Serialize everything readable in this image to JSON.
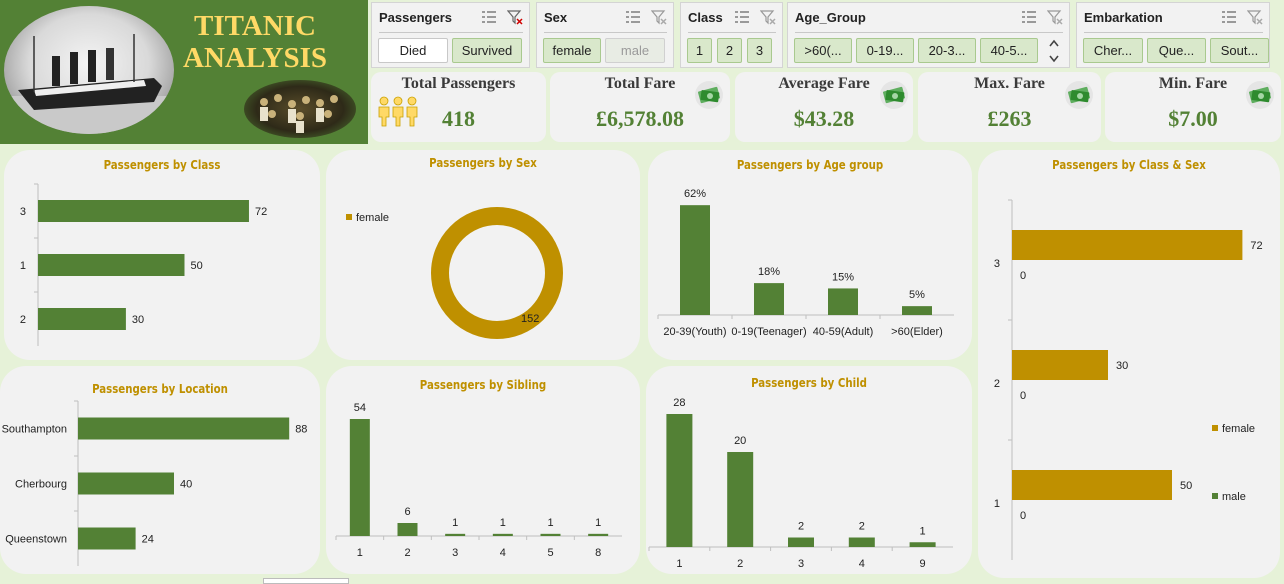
{
  "header": {
    "title_line1": "TITANIC",
    "title_line2": "ANALYSIS"
  },
  "slicers": {
    "passengers": {
      "title": "Passengers",
      "items": [
        "Died",
        "Survived"
      ]
    },
    "sex": {
      "title": "Sex",
      "items": [
        "female",
        "male"
      ]
    },
    "class": {
      "title": "Class",
      "items": [
        "1",
        "2",
        "3"
      ]
    },
    "age_group": {
      "title": "Age_Group",
      "items": [
        ">60(...",
        "0-19...",
        "20-3...",
        "40-5..."
      ]
    },
    "embarkation": {
      "title": "Embarkation",
      "items": [
        "Cher...",
        "Que...",
        "Sout..."
      ]
    }
  },
  "kpis": [
    {
      "label": "Total Passengers",
      "value": "418",
      "icon": "people-icon"
    },
    {
      "label": "Total Fare",
      "value": "£6,578.08",
      "icon": "money-icon"
    },
    {
      "label": "Average Fare",
      "value": "$43.28",
      "icon": "money-icon"
    },
    {
      "label": "Max. Fare",
      "value": "£263",
      "icon": "money-icon"
    },
    {
      "label": "Min. Fare",
      "value": "$7.00",
      "icon": "money-icon"
    }
  ],
  "colors": {
    "green": "#538135",
    "gold": "#bf9000",
    "title_gold": "#ffd966"
  },
  "chart_data": [
    {
      "id": "by_class",
      "type": "bar",
      "orientation": "horizontal",
      "title": "Passengers by Class",
      "categories": [
        "3",
        "1",
        "2"
      ],
      "values": [
        72,
        50,
        30
      ],
      "xlim": [
        0,
        100
      ]
    },
    {
      "id": "by_sex",
      "type": "pie",
      "subtype": "donut",
      "title": "Passengers by Sex",
      "categories": [
        "female"
      ],
      "values": [
        152
      ],
      "legend": "left"
    },
    {
      "id": "by_age",
      "type": "bar",
      "title": "Passengers by Age group",
      "categories": [
        "20-39(Youth)",
        "0-19(Teenager)",
        "40-59(Adult)",
        ">60(Elder)"
      ],
      "values": [
        62,
        18,
        15,
        5
      ],
      "labels": [
        "62%",
        "18%",
        "15%",
        "5%"
      ],
      "ylim": [
        0,
        70
      ]
    },
    {
      "id": "by_class_sex",
      "type": "bar",
      "orientation": "horizontal",
      "title": "Passengers by Class & Sex",
      "categories": [
        "3",
        "2",
        "1"
      ],
      "series": [
        {
          "name": "female",
          "values": [
            72,
            30,
            50
          ]
        },
        {
          "name": "male",
          "values": [
            0,
            0,
            0
          ]
        }
      ],
      "legend": "right",
      "xlim": [
        0,
        80
      ]
    },
    {
      "id": "by_location",
      "type": "bar",
      "orientation": "horizontal",
      "title": "Passengers by Location",
      "categories": [
        "Southampton",
        "Cherbourg",
        "Queenstown"
      ],
      "values": [
        88,
        40,
        24
      ],
      "xlim": [
        0,
        100
      ]
    },
    {
      "id": "by_sibling",
      "type": "bar",
      "title": "Passengers by Sibling",
      "categories": [
        "1",
        "2",
        "3",
        "4",
        "5",
        "8"
      ],
      "values": [
        54,
        6,
        1,
        1,
        1,
        1
      ],
      "ylim": [
        0,
        60
      ]
    },
    {
      "id": "by_child",
      "type": "bar",
      "title": "Passengers by Child",
      "categories": [
        "1",
        "2",
        "3",
        "4",
        "9"
      ],
      "values": [
        28,
        20,
        2,
        2,
        1
      ],
      "ylim": [
        0,
        32
      ]
    }
  ],
  "sheet_tabs": [
    ""
  ]
}
